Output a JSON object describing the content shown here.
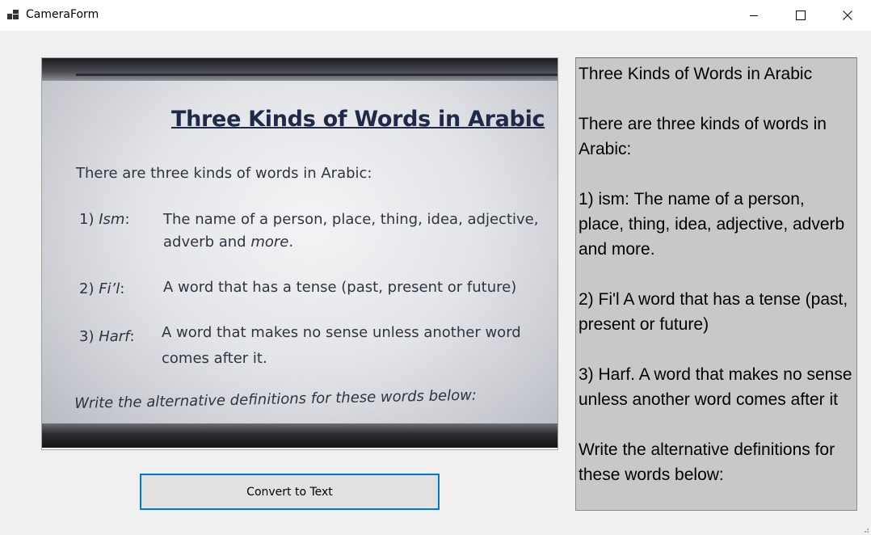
{
  "window": {
    "title": "CameraForm",
    "controls": [
      "minimize-icon",
      "maximize-icon",
      "close-icon"
    ]
  },
  "camera_view": {
    "slide": {
      "title": "Three Kinds of Words in Arabic",
      "intro": "There are three kinds of words in Arabic:",
      "items": [
        {
          "num": "1) ",
          "term": "Ism",
          "suffix": ":",
          "def_line1": "The name of a person, place, thing, idea, adjective,",
          "def_line2_a": "adverb and ",
          "def_line2_b": "more",
          "def_line2_c": "."
        },
        {
          "num": "2) ",
          "term": "Fi’l",
          "suffix": ":",
          "def_line1": "A word that has a tense (past, present or future)"
        },
        {
          "num": "3) ",
          "term": "Harf",
          "suffix": ":",
          "def_line1": "A word that makes no sense unless another word",
          "def_line2": "comes after it."
        }
      ],
      "footer": "Write the alternative definitions for these words below:"
    }
  },
  "ocr_output": {
    "text": "Three Kinds of Words in Arabic\n\nThere are three kinds of words in Arabic:\n\n1) ism: The name of a person, place, thing, idea, adjective, adverb and more.\n\n2) Fi'l A word that has a tense (past, present or future)\n\n3) Harf. A word that makes no sense unless another word comes after it\n\nWrite the alternative definitions for these words below:"
  },
  "actions": {
    "convert_label": "Convert to Text"
  },
  "colors": {
    "accent": "#0078d7",
    "ocr_background": "#c8c8c8",
    "window_background": "#f0f0f0"
  }
}
